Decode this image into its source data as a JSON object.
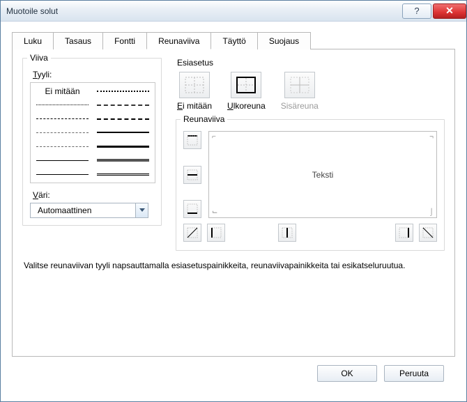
{
  "window": {
    "title": "Muotoile solut"
  },
  "tabs": [
    {
      "label": "Luku"
    },
    {
      "label": "Tasaus"
    },
    {
      "label": "Fontti"
    },
    {
      "label": "Reunaviiva",
      "active": true
    },
    {
      "label": "Täyttö"
    },
    {
      "label": "Suojaus"
    }
  ],
  "line_group": {
    "title": "Viiva",
    "style_label": "Tyyli:",
    "none_label": "Ei mitään",
    "color_label": "Väri:",
    "color_value": "Automaattinen"
  },
  "presets": {
    "title": "Esiasetus",
    "items": [
      {
        "label": "Ei mitään",
        "name": "preset-none"
      },
      {
        "label": "Ulkoreuna",
        "name": "preset-outline"
      },
      {
        "label": "Sisäreuna",
        "name": "preset-inside"
      }
    ]
  },
  "border_group": {
    "title": "Reunaviiva",
    "preview_text": "Teksti",
    "side_buttons": [
      {
        "name": "border-top-button",
        "icon": "top"
      },
      {
        "name": "border-middle-h-button",
        "icon": "mid-h"
      },
      {
        "name": "border-bottom-button",
        "icon": "bottom"
      }
    ],
    "bottom_buttons_left": [
      {
        "name": "border-diag-up-button",
        "icon": "diag-up"
      },
      {
        "name": "border-left-button",
        "icon": "left"
      }
    ],
    "bottom_buttons_mid": [
      {
        "name": "border-middle-v-button",
        "icon": "mid-v"
      }
    ],
    "bottom_buttons_right": [
      {
        "name": "border-right-button",
        "icon": "right"
      },
      {
        "name": "border-diag-down-button",
        "icon": "diag-down"
      }
    ]
  },
  "hint_text": "Valitse reunaviivan tyyli napsauttamalla esiasetuspainikkeita, reunaviivapainikkeita tai esikatseluruutua.",
  "buttons": {
    "ok": "OK",
    "cancel": "Peruuta"
  },
  "style_swatches": [
    "none",
    "dot-s",
    "dot-s",
    "dot-m",
    "dash-s",
    "ddash",
    "dashdot",
    "dash-m",
    "dashdot",
    "solid-m",
    "solid-s",
    "solid-l",
    "solid-h",
    "double"
  ]
}
